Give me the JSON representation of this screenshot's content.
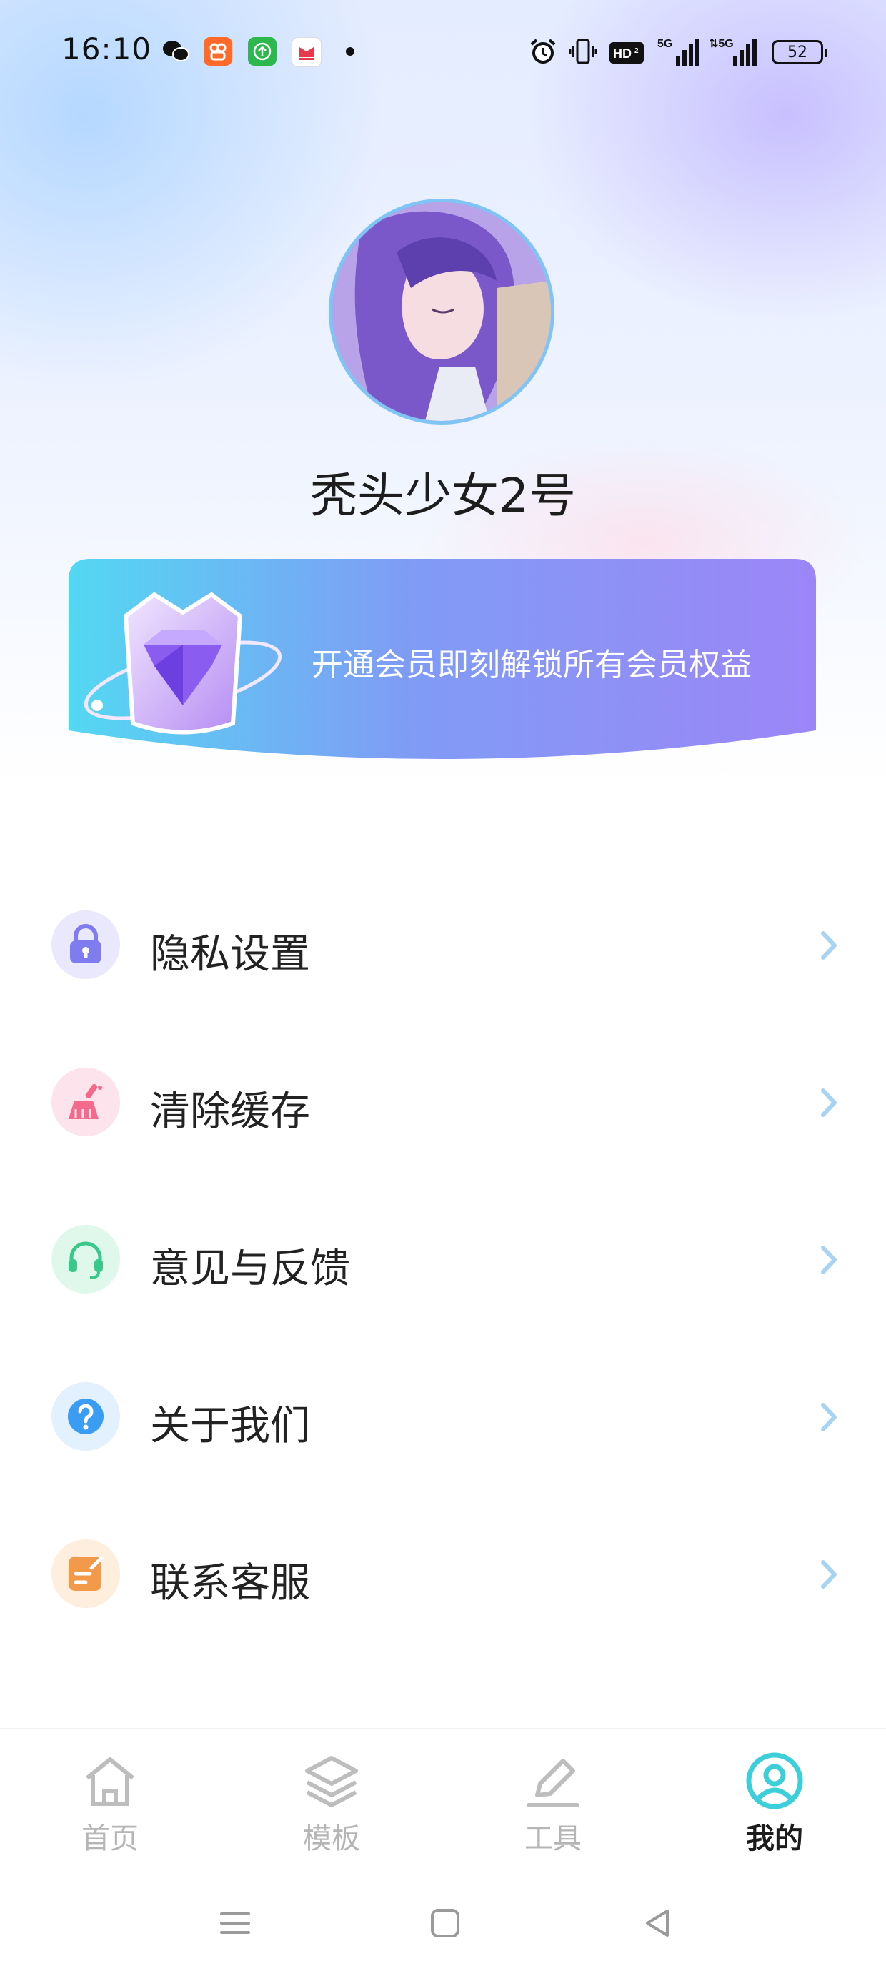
{
  "status_bar": {
    "time": "16:10",
    "battery": "52",
    "network": "5G",
    "apps": [
      {
        "icon": "wechat-icon",
        "color": "#111111"
      },
      {
        "icon": "kuaishou-icon",
        "color": "#ff6a2b"
      },
      {
        "icon": "upload-icon",
        "color": "#2db84d"
      },
      {
        "icon": "news-icon",
        "color": "#e8384f"
      }
    ]
  },
  "profile": {
    "username": "秃头少女2号"
  },
  "vip_banner": {
    "text": "开通会员即刻解锁所有会员权益",
    "gradient_start": "#53d8f2",
    "gradient_end": "#9c86f7"
  },
  "menu": [
    {
      "label": "隐私设置",
      "icon": "lock-icon",
      "icon_color": "#7f7cf0",
      "bg_color": "#e9e8fd"
    },
    {
      "label": "清除缓存",
      "icon": "broom-icon",
      "icon_color": "#f36a8d",
      "bg_color": "#fde4ec"
    },
    {
      "label": "意见与反馈",
      "icon": "headset-icon",
      "icon_color": "#38c98a",
      "bg_color": "#e0f7ec"
    },
    {
      "label": "关于我们",
      "icon": "question-icon",
      "icon_color": "#3a9cf2",
      "bg_color": "#e3f0fd"
    },
    {
      "label": "联系客服",
      "icon": "note-edit-icon",
      "icon_color": "#f39a4a",
      "bg_color": "#fdeedd"
    }
  ],
  "bottom_nav": {
    "items": [
      {
        "label": "首页",
        "icon": "home-icon",
        "active": false
      },
      {
        "label": "模板",
        "icon": "layers-icon",
        "active": false
      },
      {
        "label": "工具",
        "icon": "pen-icon",
        "active": false
      },
      {
        "label": "我的",
        "icon": "user-icon",
        "active": true
      }
    ],
    "active_color": "#3ccfd9"
  }
}
